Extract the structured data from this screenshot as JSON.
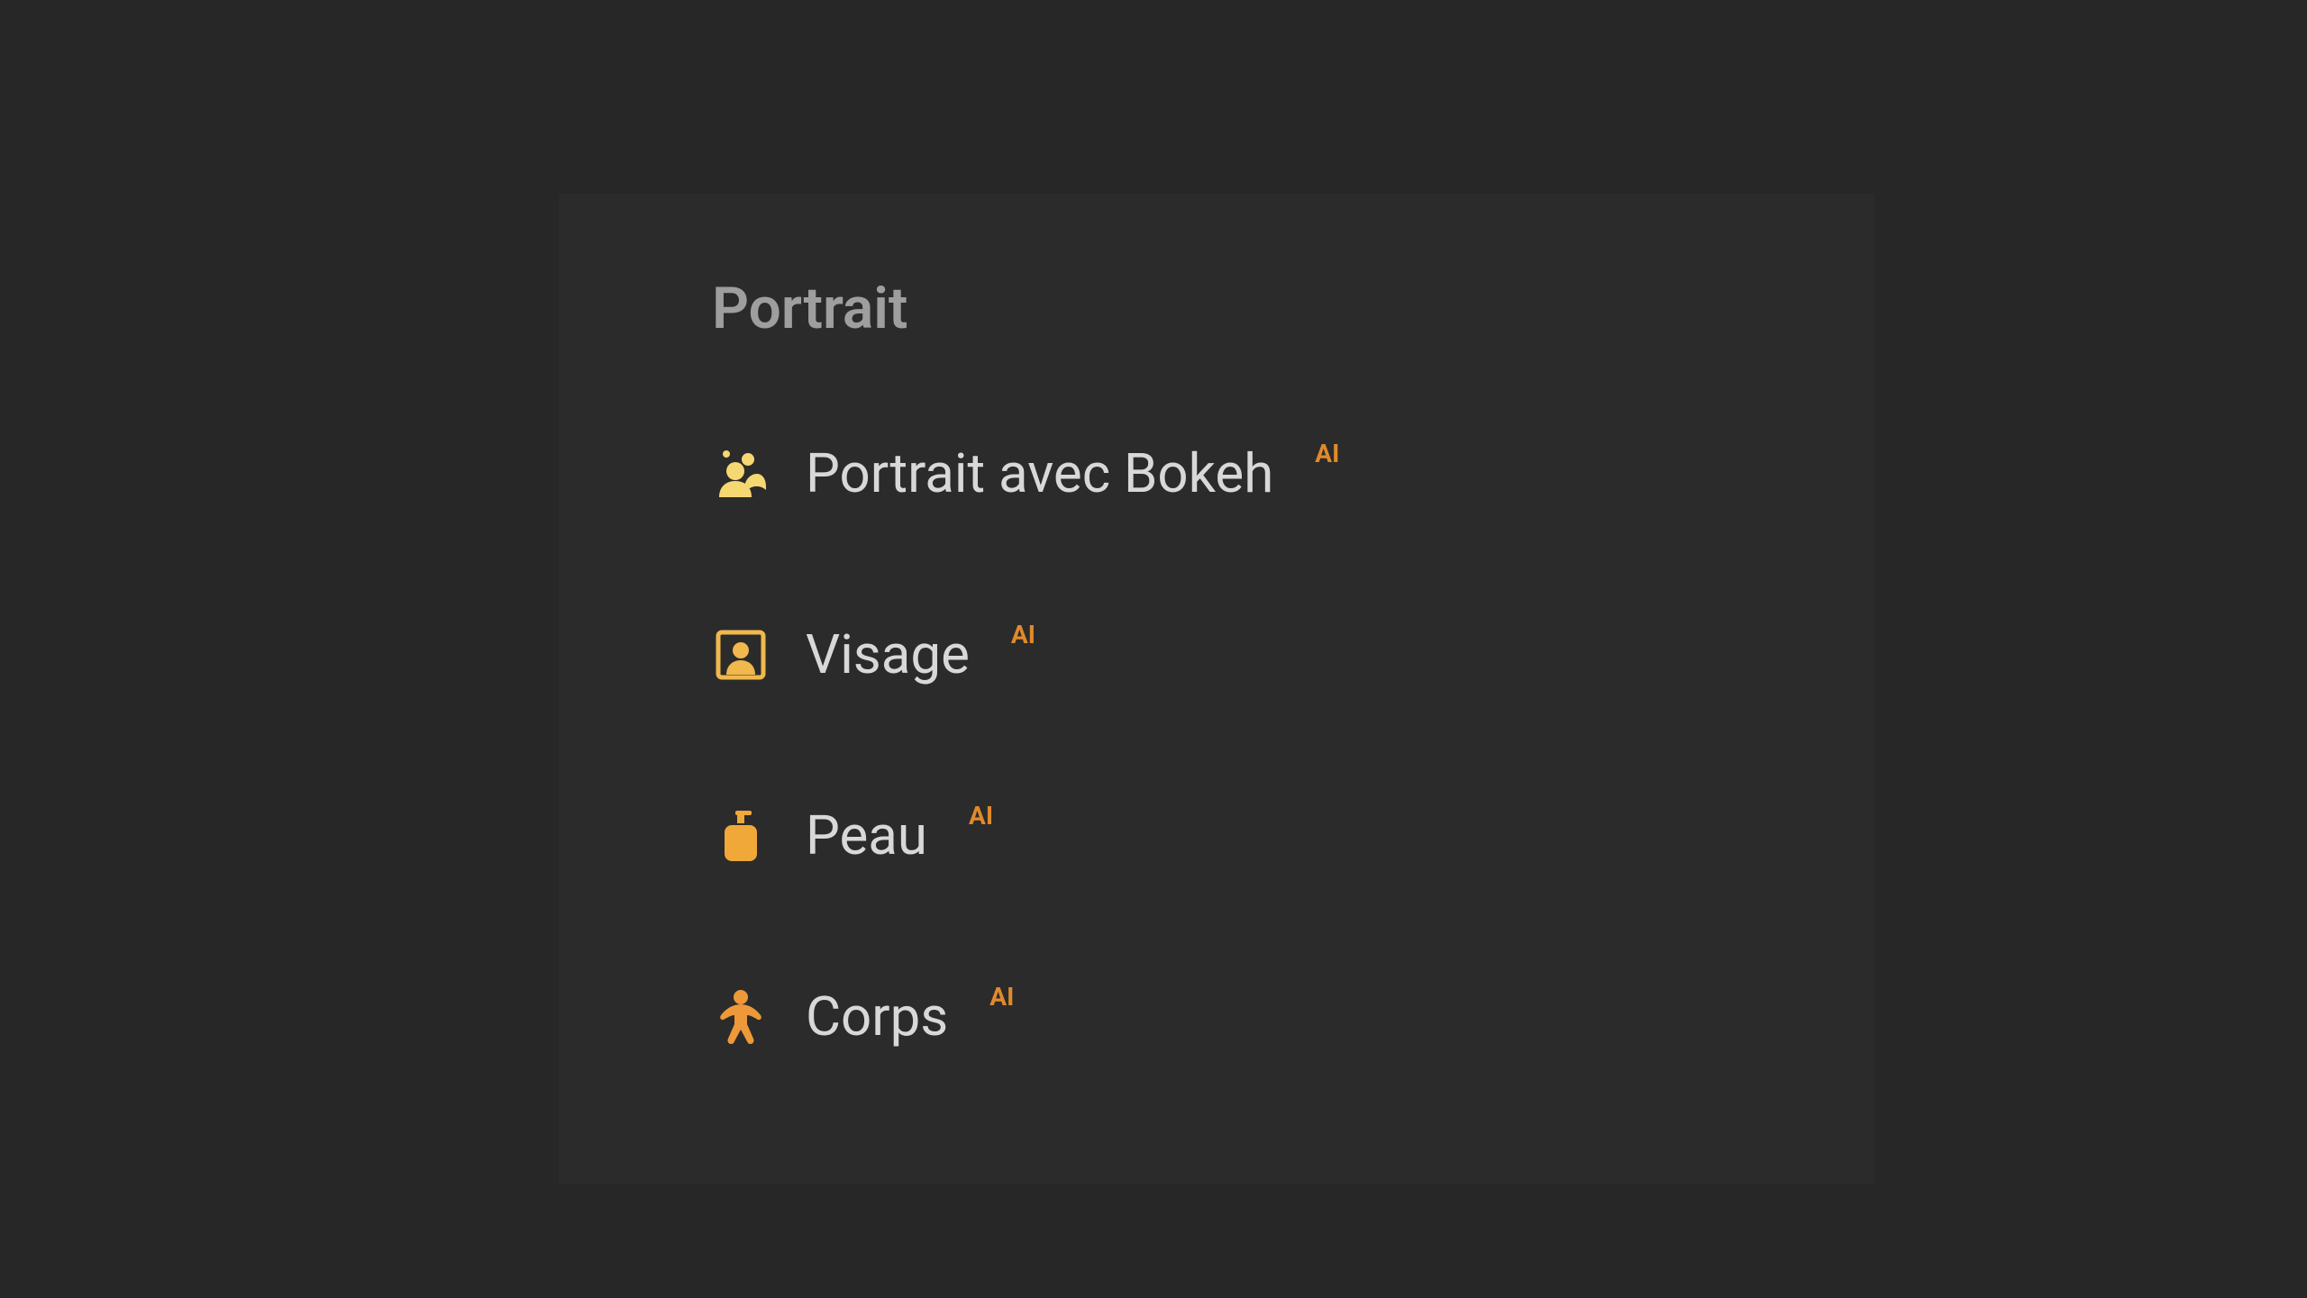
{
  "section": {
    "title": "Portrait"
  },
  "items": [
    {
      "label": "Portrait avec Bokeh",
      "badge": "AI",
      "icon": "people-icon",
      "color": "#f5d872"
    },
    {
      "label": "Visage",
      "badge": "AI",
      "icon": "portrait-frame-icon",
      "color": "#f0b84d"
    },
    {
      "label": "Peau",
      "badge": "AI",
      "icon": "lotion-icon",
      "color": "#f0a838"
    },
    {
      "label": "Corps",
      "badge": "AI",
      "icon": "body-icon",
      "color": "#ed993a"
    }
  ],
  "colors": {
    "bg": "#272727",
    "panel": "#2b2b2b",
    "title": "#9e9e9e",
    "label": "#d8d8d8",
    "badge": "#e08a2c"
  }
}
